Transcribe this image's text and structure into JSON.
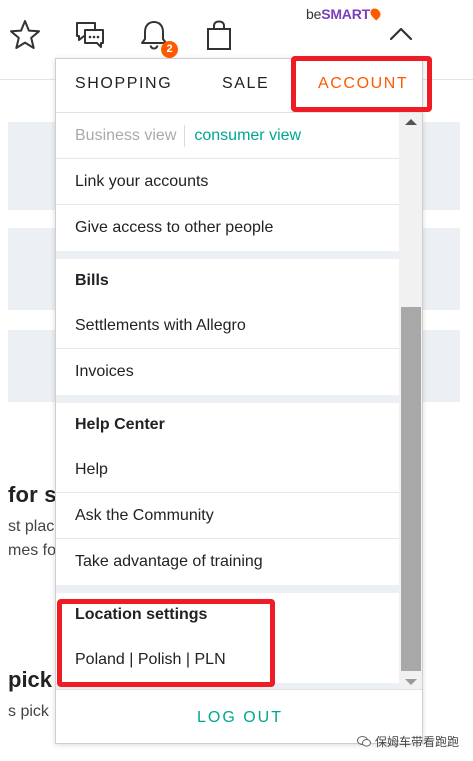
{
  "header": {
    "icons": [
      "star-icon",
      "chat-icon",
      "bell-icon",
      "bag-icon",
      "chevron-up-icon"
    ],
    "notification_count": "2",
    "logo": {
      "prefix": "be",
      "brand": "SMART",
      "accent": "#ff5a00"
    }
  },
  "background_page": {
    "heading_1": "for s",
    "line_1": "st plac",
    "line_2": "mes fo",
    "heading_2": "pick",
    "line_3": "s pick"
  },
  "dropdown": {
    "tabs": [
      {
        "label": "SHOPPING"
      },
      {
        "label": "SALE"
      },
      {
        "label": "ACCOUNT",
        "active": true
      }
    ],
    "view_toggle": {
      "business": "Business view",
      "consumer": "consumer view"
    },
    "account_items": [
      "Link your accounts",
      "Give access to other people"
    ],
    "bills": {
      "heading": "Bills",
      "items": [
        "Settlements with Allegro",
        "Invoices"
      ]
    },
    "help": {
      "heading": "Help Center",
      "items": [
        "Help",
        "Ask the Community",
        "Take advantage of training"
      ]
    },
    "location": {
      "heading": "Location settings",
      "value": "Poland | Polish | PLN"
    },
    "logout": "LOG OUT"
  },
  "colors": {
    "accent_orange": "#ff5a00",
    "accent_teal": "#00a790",
    "highlight_red": "#ee1c25",
    "page_bg": "#eceff3"
  },
  "watermark": "保姆车带看跑跑"
}
